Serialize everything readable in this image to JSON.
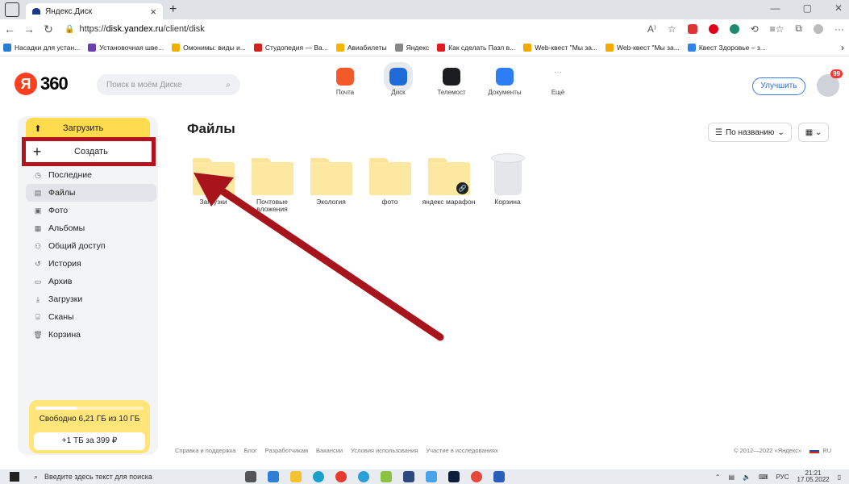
{
  "browser": {
    "tab_title": "Яндекс.Диск",
    "url_prefix": "https://",
    "url_host": "disk.yandex.ru",
    "url_path": "/client/disk",
    "bookmarks": [
      {
        "label": "Насадки для устан...",
        "color": "#2a7bd6"
      },
      {
        "label": "Установочная шве...",
        "color": "#6a3fb0"
      },
      {
        "label": "Омонимы: виды и...",
        "color": "#f0b000"
      },
      {
        "label": "Студопедия — Ва...",
        "color": "#d6201b"
      },
      {
        "label": "Авиабилеты",
        "color": "#f5b400"
      },
      {
        "label": "Яндекс",
        "color": "#888888"
      },
      {
        "label": "Как сделать Пазл в...",
        "color": "#e31b23"
      },
      {
        "label": "Web-квест \"Мы за...",
        "color": "#f2a900"
      },
      {
        "label": "Web-квест \"Мы за...",
        "color": "#f2a900"
      },
      {
        "label": "Квест Здоровье – з...",
        "color": "#2e84e8"
      }
    ]
  },
  "header": {
    "logo_letter": "Я",
    "logo_text": "360",
    "search_placeholder": "Поиск в моём Диске",
    "services": [
      {
        "label": "Почта",
        "color": "#f25a2a",
        "active": false
      },
      {
        "label": "Диск",
        "color": "#1e6bd8",
        "active": true
      },
      {
        "label": "Телемост",
        "color": "#1b1d20",
        "active": false
      },
      {
        "label": "Документы",
        "color": "#2d7df5",
        "active": false
      },
      {
        "label": "Ещё",
        "color": "#ffffff",
        "active": false
      }
    ],
    "upgrade_label": "Улучшить",
    "avatar_badge": "99"
  },
  "sidebar": {
    "upload_label": "Загрузить",
    "create_label": "Создать",
    "items": [
      {
        "label": "Последние",
        "icon": "clock-icon",
        "glyph": "◷",
        "active": false
      },
      {
        "label": "Файлы",
        "icon": "file-icon",
        "glyph": "▤",
        "active": true
      },
      {
        "label": "Фото",
        "icon": "photo-icon",
        "glyph": "▣",
        "active": false
      },
      {
        "label": "Альбомы",
        "icon": "album-icon",
        "glyph": "▦",
        "active": false
      },
      {
        "label": "Общий доступ",
        "icon": "shared-icon",
        "glyph": "⚇",
        "active": false
      },
      {
        "label": "История",
        "icon": "history-icon",
        "glyph": "↺",
        "active": false
      },
      {
        "label": "Архив",
        "icon": "archive-icon",
        "glyph": "▭",
        "active": false
      },
      {
        "label": "Загрузки",
        "icon": "download-icon",
        "glyph": "⤓",
        "active": false
      },
      {
        "label": "Сканы",
        "icon": "scan-icon",
        "glyph": "⌸",
        "active": false
      },
      {
        "label": "Корзина",
        "icon": "trash-icon",
        "glyph": "🗑",
        "active": false
      }
    ],
    "storage_text": "Свободно 6,21 ГБ из 10 ГБ",
    "storage_used_fraction": 0.38,
    "buy_label": "+1 ТБ за 399 ₽"
  },
  "main": {
    "title": "Файлы",
    "sort_label": "По названию",
    "files": [
      {
        "name": "Загрузки",
        "type": "folder",
        "shared": false
      },
      {
        "name": "Почтовые вложения",
        "type": "folder",
        "shared": false
      },
      {
        "name": "Экология",
        "type": "folder",
        "shared": false
      },
      {
        "name": "фото",
        "type": "folder",
        "shared": false
      },
      {
        "name": "яндекс марафон",
        "type": "folder",
        "shared": true
      },
      {
        "name": "Корзина",
        "type": "trash",
        "shared": false
      }
    ]
  },
  "footer": {
    "links": [
      "Справка и поддержка",
      "Блог",
      "Разработчикам",
      "Вакансии",
      "Условия использования",
      "Участие в исследованиях"
    ],
    "copyright": "© 2012—2022 «Яндекс»",
    "lang": "RU"
  },
  "taskbar": {
    "search_placeholder": "Введите здесь текст для поиска",
    "lang": "РУС",
    "time": "21:21",
    "date": "17.05.2022"
  },
  "annotation_color": "#a8141c"
}
